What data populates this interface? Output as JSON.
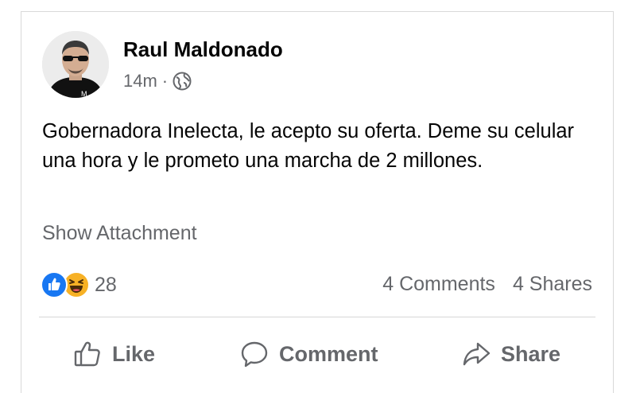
{
  "post": {
    "author": "Raul Maldonado",
    "time": "14m",
    "dot": "·",
    "privacy_icon": "globe-icon",
    "text": "Gobernadora Inelecta, le acepto su oferta. Deme su celular una hora y le prometo una marcha de 2 millones.",
    "attachment_link": "Show Attachment"
  },
  "reactions": {
    "icons": [
      "like-reaction-icon",
      "haha-reaction-icon"
    ],
    "count": "28"
  },
  "stats": {
    "comments": "4 Comments",
    "shares": "4 Shares"
  },
  "actions": {
    "like": "Like",
    "comment": "Comment",
    "share": "Share"
  },
  "colors": {
    "like_blue": "#1877f2",
    "haha_yellow": "#f7b125",
    "secondary_text": "#65676b",
    "primary_text": "#050505"
  }
}
